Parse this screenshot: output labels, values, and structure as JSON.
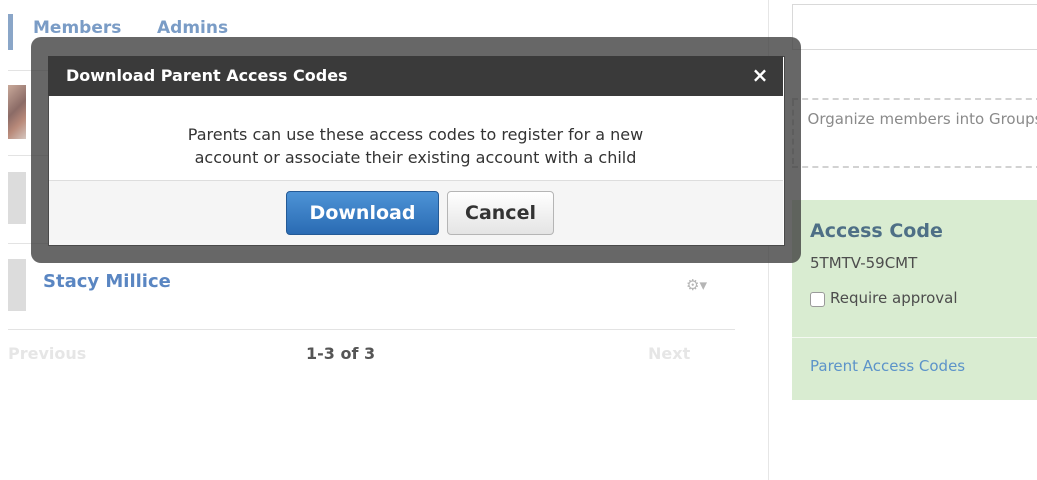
{
  "tabs": [
    "Members",
    "Admins"
  ],
  "members": [
    {
      "name": ""
    },
    {
      "name": ""
    },
    {
      "name": "Stacy Millice"
    }
  ],
  "row_menu": {
    "icon": "gear-icon",
    "glyph": "⚙▾"
  },
  "pager": {
    "previous": "Previous",
    "count": "1-3 of 3",
    "next": "Next"
  },
  "sidebar": {
    "search_placeholder": "",
    "organize_text": "Organize members into Groups",
    "access_code": {
      "title": "Access Code",
      "code": "5TMTV-59CMT",
      "require_approval_label": "Require approval",
      "require_approval_checked": false
    },
    "parent_access_link": "Parent Access Codes"
  },
  "modal": {
    "title": "Download Parent Access Codes",
    "close_glyph": "×",
    "body_line1": "Parents can use these access codes to register for a new",
    "body_line2": "account or associate their existing account with a child",
    "download_label": "Download",
    "cancel_label": "Cancel"
  },
  "colors": {
    "link": "#5a86c2",
    "access_panel": "#d9ecd1",
    "primary_button": "#2a6bb3",
    "modal_header": "#3a3a3a"
  }
}
